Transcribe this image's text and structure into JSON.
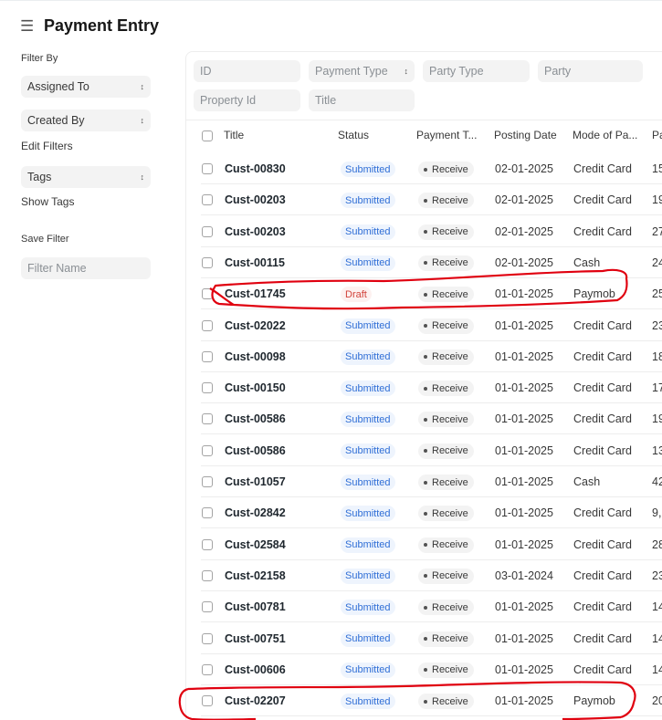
{
  "page": {
    "title": "Payment Entry"
  },
  "sidebar": {
    "filter_by": "Filter By",
    "assigned_to": "Assigned To",
    "created_by": "Created By",
    "edit_filters": "Edit Filters",
    "tags": "Tags",
    "show_tags": "Show Tags",
    "save_filter": "Save Filter",
    "filter_name_placeholder": "Filter Name"
  },
  "filters": {
    "id": "ID",
    "payment_type": "Payment Type",
    "party_type": "Party Type",
    "party": "Party",
    "property_id": "Property Id",
    "title": "Title"
  },
  "table": {
    "columns": [
      "Title",
      "Status",
      "Payment T...",
      "Posting Date",
      "Mode of Pa...",
      "Pa"
    ],
    "rows": [
      {
        "title": "Cust-00830",
        "status": "Submitted",
        "type": "Receive",
        "date": "02-01-2025",
        "mode": "Credit Card",
        "paid": "15"
      },
      {
        "title": "Cust-00203",
        "status": "Submitted",
        "type": "Receive",
        "date": "02-01-2025",
        "mode": "Credit Card",
        "paid": "19"
      },
      {
        "title": "Cust-00203",
        "status": "Submitted",
        "type": "Receive",
        "date": "02-01-2025",
        "mode": "Credit Card",
        "paid": "27"
      },
      {
        "title": "Cust-00115",
        "status": "Submitted",
        "type": "Receive",
        "date": "02-01-2025",
        "mode": "Cash",
        "paid": "24"
      },
      {
        "title": "Cust-01745",
        "status": "Draft",
        "type": "Receive",
        "date": "01-01-2025",
        "mode": "Paymob",
        "paid": "25"
      },
      {
        "title": "Cust-02022",
        "status": "Submitted",
        "type": "Receive",
        "date": "01-01-2025",
        "mode": "Credit Card",
        "paid": "23"
      },
      {
        "title": "Cust-00098",
        "status": "Submitted",
        "type": "Receive",
        "date": "01-01-2025",
        "mode": "Credit Card",
        "paid": "18"
      },
      {
        "title": "Cust-00150",
        "status": "Submitted",
        "type": "Receive",
        "date": "01-01-2025",
        "mode": "Credit Card",
        "paid": "17"
      },
      {
        "title": "Cust-00586",
        "status": "Submitted",
        "type": "Receive",
        "date": "01-01-2025",
        "mode": "Credit Card",
        "paid": "19"
      },
      {
        "title": "Cust-00586",
        "status": "Submitted",
        "type": "Receive",
        "date": "01-01-2025",
        "mode": "Credit Card",
        "paid": "13"
      },
      {
        "title": "Cust-01057",
        "status": "Submitted",
        "type": "Receive",
        "date": "01-01-2025",
        "mode": "Cash",
        "paid": "42"
      },
      {
        "title": "Cust-02842",
        "status": "Submitted",
        "type": "Receive",
        "date": "01-01-2025",
        "mode": "Credit Card",
        "paid": "9,"
      },
      {
        "title": "Cust-02584",
        "status": "Submitted",
        "type": "Receive",
        "date": "01-01-2025",
        "mode": "Credit Card",
        "paid": "28"
      },
      {
        "title": "Cust-02158",
        "status": "Submitted",
        "type": "Receive",
        "date": "03-01-2024",
        "mode": "Credit Card",
        "paid": "23"
      },
      {
        "title": "Cust-00781",
        "status": "Submitted",
        "type": "Receive",
        "date": "01-01-2025",
        "mode": "Credit Card",
        "paid": "14"
      },
      {
        "title": "Cust-00751",
        "status": "Submitted",
        "type": "Receive",
        "date": "01-01-2025",
        "mode": "Credit Card",
        "paid": "14"
      },
      {
        "title": "Cust-00606",
        "status": "Submitted",
        "type": "Receive",
        "date": "01-01-2025",
        "mode": "Credit Card",
        "paid": "14"
      },
      {
        "title": "Cust-02207",
        "status": "Submitted",
        "type": "Receive",
        "date": "01-01-2025",
        "mode": "Paymob",
        "paid": "20"
      }
    ]
  },
  "colors": {
    "annotation": "#e0000f",
    "submitted": "#2f6ed6",
    "draft": "#d2423a"
  }
}
